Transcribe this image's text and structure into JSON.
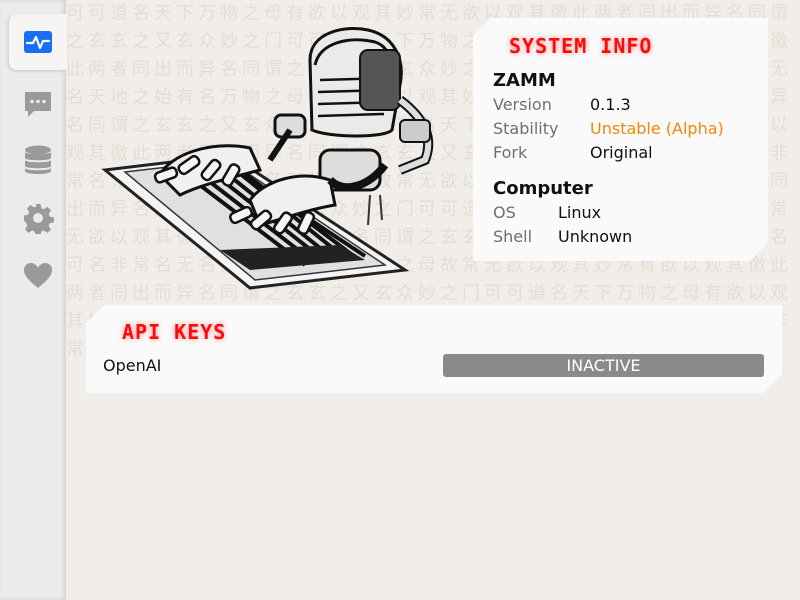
{
  "sidebar": {
    "items": [
      {
        "icon": "pulse-icon",
        "active": true
      },
      {
        "icon": "chat-icon",
        "active": false
      },
      {
        "icon": "database-icon",
        "active": false
      },
      {
        "icon": "gear-icon",
        "active": false
      },
      {
        "icon": "heart-icon",
        "active": false
      }
    ],
    "accent_color": "#1a6ef5"
  },
  "system_info": {
    "title": "SYSTEM INFO",
    "app_section": "ZAMM",
    "version_label": "Version",
    "version_value": "0.1.3",
    "stability_label": "Stability",
    "stability_value": "Unstable (Alpha)",
    "fork_label": "Fork",
    "fork_value": "Original",
    "computer_section": "Computer",
    "os_label": "OS",
    "os_value": "Linux",
    "shell_label": "Shell",
    "shell_value": "Unknown"
  },
  "api_keys": {
    "title": "API KEYS",
    "rows": [
      {
        "service": "OpenAI",
        "status": "INACTIVE"
      }
    ]
  },
  "colors": {
    "title_red": "#ff0a0a",
    "stability_orange": "#f0890a",
    "inactive_gray": "#8a8a8a"
  }
}
